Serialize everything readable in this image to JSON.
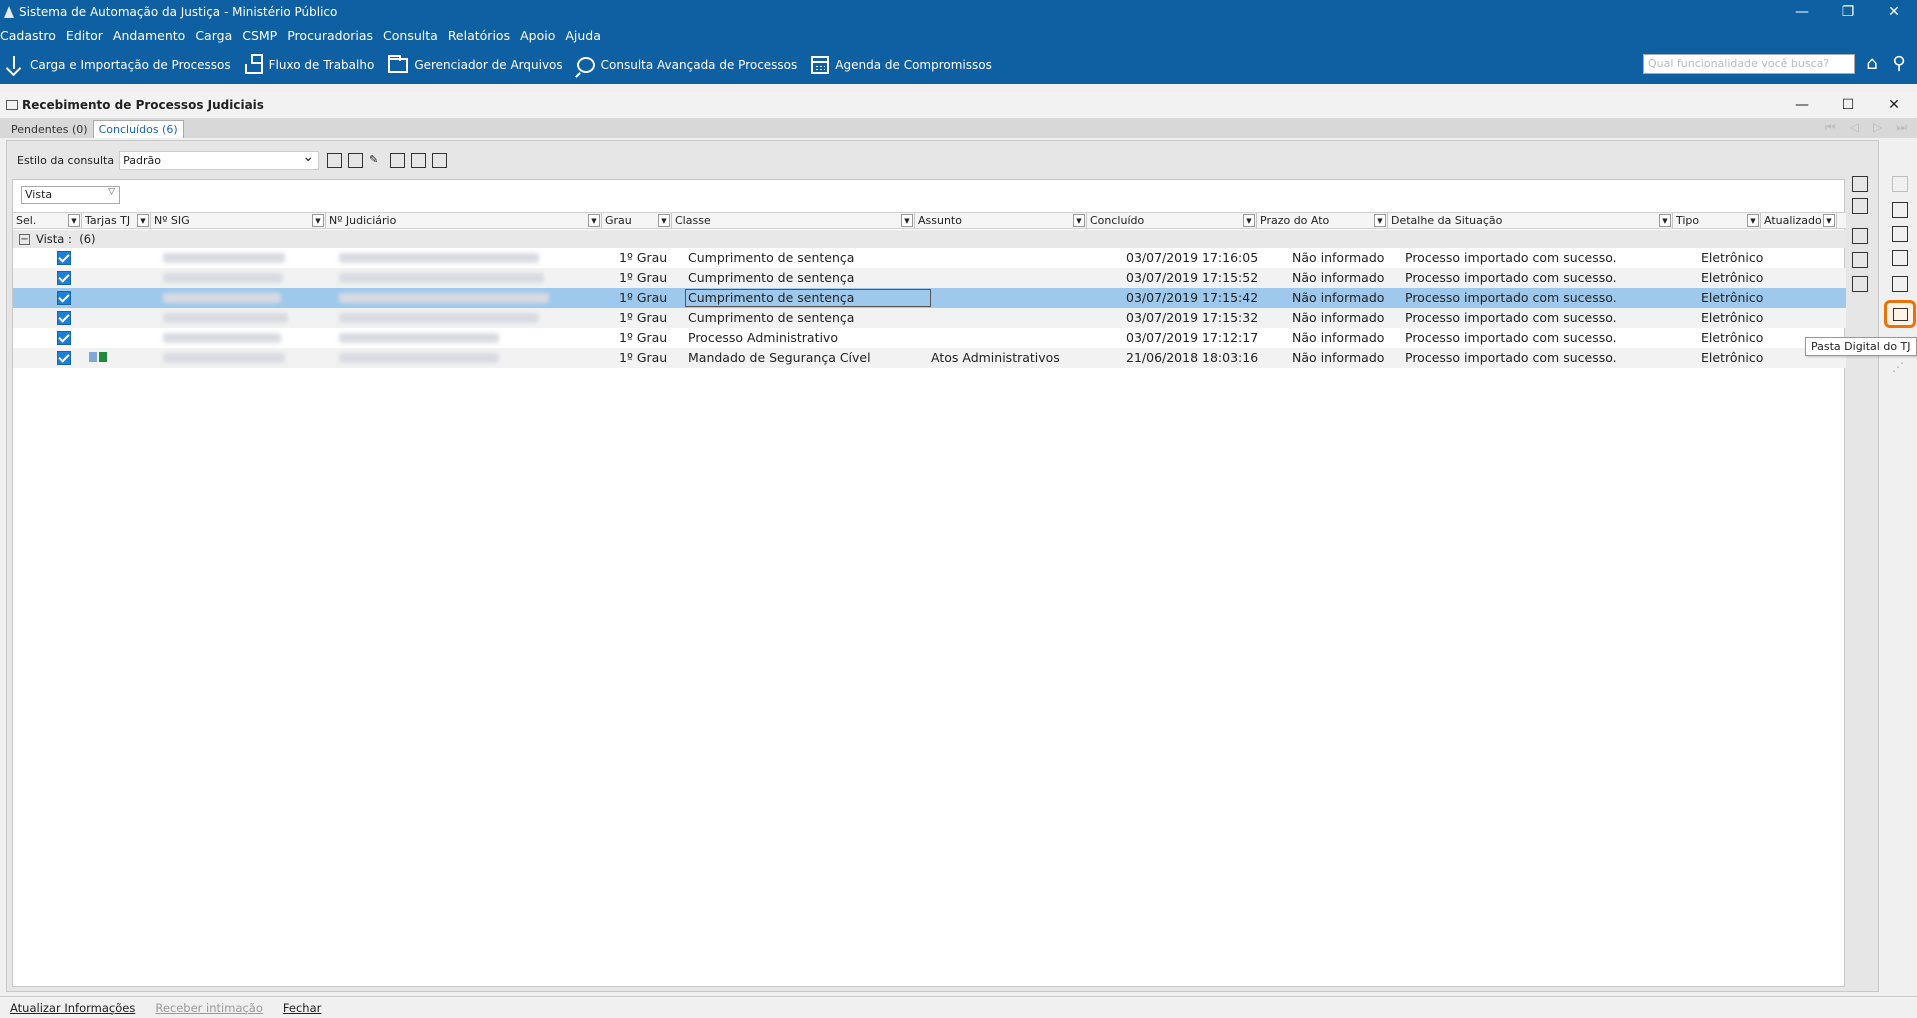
{
  "window": {
    "title": "Sistema de Automação da Justiça - Ministério Público",
    "controls": [
      "—",
      "❐",
      "✕"
    ]
  },
  "menu": [
    "Cadastro",
    "Editor",
    "Andamento",
    "Carga",
    "CSMP",
    "Procuradorias",
    "Consulta",
    "Relatórios",
    "Apoio",
    "Ajuda"
  ],
  "toolbar": {
    "items": [
      {
        "label": "Carga e Importação de Processos",
        "icon": "download-icon"
      },
      {
        "label": "Fluxo de Trabalho",
        "icon": "workflow-icon"
      },
      {
        "label": "Gerenciador de Arquivos",
        "icon": "folder-icon"
      },
      {
        "label": "Consulta Avançada de Processos",
        "icon": "chat-search-icon"
      },
      {
        "label": "Agenda de Compromissos",
        "icon": "calendar-icon"
      }
    ],
    "search_placeholder": "Qual funcionalidade você busca?"
  },
  "inner_window": {
    "title": "Recebimento de Processos Judiciais",
    "controls": [
      "—",
      "☐",
      "✕"
    ]
  },
  "tabs": [
    {
      "label": "Pendentes (0)",
      "active": false
    },
    {
      "label": "Concluídos (6)",
      "active": true
    }
  ],
  "pager": [
    "⏮",
    "◁",
    "▷",
    "⏭"
  ],
  "query": {
    "label": "Estilo da consulta",
    "value": "Padrão"
  },
  "vista_filter": "Vista",
  "columns": [
    "Sel.",
    "Tarjas TJ",
    "Nº SIG",
    "Nº Judiciário",
    "Grau",
    "Classe",
    "Assunto",
    "Concluído",
    "Prazo do Ato",
    "Detalhe da Situação",
    "Tipo",
    "Atualizado"
  ],
  "group": {
    "label": "Vista :",
    "count": "(6)"
  },
  "rows": [
    {
      "grau": "1º Grau",
      "classe": "Cumprimento de sentença",
      "assunto": "",
      "concluido": "03/07/2019 17:16:05",
      "prazo": "Não informado",
      "detalhe": "Processo importado com sucesso.",
      "tipo": "Eletrônico"
    },
    {
      "grau": "1º Grau",
      "classe": "Cumprimento de sentença",
      "assunto": "",
      "concluido": "03/07/2019 17:15:52",
      "prazo": "Não informado",
      "detalhe": "Processo importado com sucesso.",
      "tipo": "Eletrônico"
    },
    {
      "grau": "1º Grau",
      "classe": "Cumprimento de sentença",
      "assunto": "",
      "concluido": "03/07/2019 17:15:42",
      "prazo": "Não informado",
      "detalhe": "Processo importado com sucesso.",
      "tipo": "Eletrônico"
    },
    {
      "grau": "1º Grau",
      "classe": "Cumprimento de sentença",
      "assunto": "",
      "concluido": "03/07/2019 17:15:32",
      "prazo": "Não informado",
      "detalhe": "Processo importado com sucesso.",
      "tipo": "Eletrônico"
    },
    {
      "grau": "1º Grau",
      "classe": "Processo Administrativo",
      "assunto": "",
      "concluido": "03/07/2019 17:12:17",
      "prazo": "Não informado",
      "detalhe": "Processo importado com sucesso.",
      "tipo": "Eletrônico"
    },
    {
      "grau": "1º Grau",
      "classe": "Mandado de Segurança Cível",
      "assunto": "Atos Administrativos",
      "concluido": "21/06/2018 18:03:16",
      "prazo": "Não informado",
      "detalhe": "Processo importado com sucesso.",
      "tipo": "Eletrônico"
    }
  ],
  "selected_row": 2,
  "tooltip": "Pasta Digital do TJ",
  "status_actions": [
    {
      "label": "Atualizar Informações",
      "enabled": true
    },
    {
      "label": "Receber intimação",
      "enabled": false
    },
    {
      "label": "Fechar",
      "enabled": true
    }
  ],
  "colors": {
    "brand_blue": "#0f5fa3",
    "selected_row": "#9ec9ec",
    "highlight_orange": "#e8720c",
    "checkbox_blue": "#1a7fd6"
  }
}
